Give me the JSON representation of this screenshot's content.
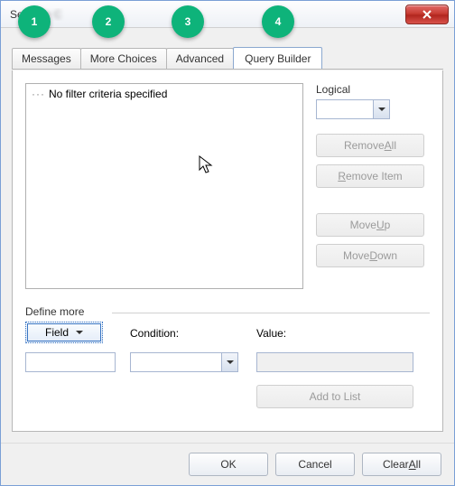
{
  "window": {
    "title_visible": "Se",
    "title_obscured": "older C"
  },
  "tabs": {
    "messages": "Messages",
    "more": "More Choices",
    "advanced": "Advanced",
    "query": "Query Builder",
    "active": "query"
  },
  "criteria": {
    "empty_text": "No filter criteria specified"
  },
  "logical": {
    "label": "Logical",
    "value": ""
  },
  "buttons": {
    "remove_all": {
      "pre": "Remove ",
      "u": "A",
      "post": "ll"
    },
    "remove_item": {
      "pre": "",
      "u": "R",
      "post": "emove Item"
    },
    "move_up": {
      "pre": "Move ",
      "u": "U",
      "post": "p"
    },
    "move_down": {
      "pre": "Move ",
      "u": "D",
      "post": "own"
    },
    "add_to_list": "Add to List",
    "ok": "OK",
    "cancel": "Cancel",
    "clear_all": {
      "pre": "Clear ",
      "u": "A",
      "post": "ll"
    }
  },
  "define": {
    "label": "Define more",
    "field_label": "Field",
    "condition_label": "Condition:",
    "value_label": "Value:",
    "condition_value": "",
    "text_value": "",
    "value_value": ""
  },
  "callouts": {
    "c1": "1",
    "c2": "2",
    "c3": "3",
    "c4": "4"
  }
}
